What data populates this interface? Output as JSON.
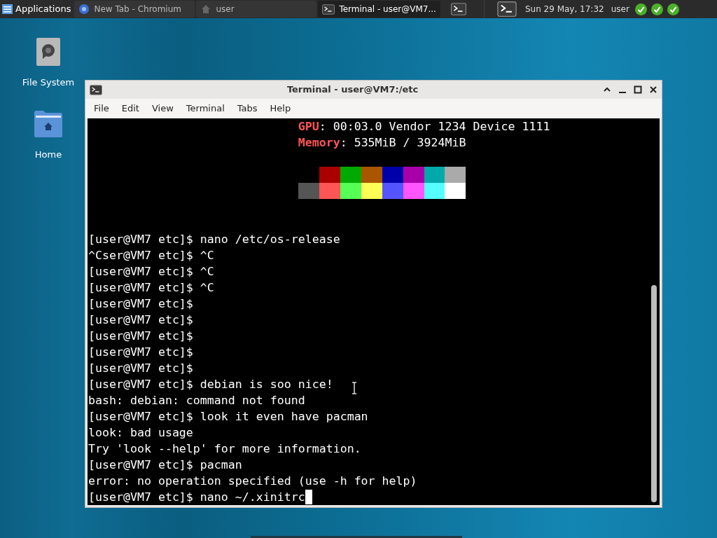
{
  "taskbar": {
    "menu": "Applications",
    "tasks": [
      {
        "label": "New Tab - Chromium",
        "kind": "browser",
        "selected": false
      },
      {
        "label": "user",
        "kind": "folder",
        "selected": false
      },
      {
        "label": "Terminal - user@VM7...",
        "kind": "terminal",
        "selected": true
      }
    ],
    "clock": "Sun 29 May, 17:32",
    "user": "user"
  },
  "desktop_icons": [
    {
      "label": "File System",
      "kind": "drive"
    },
    {
      "label": "Home",
      "kind": "home"
    }
  ],
  "window": {
    "title": "Terminal - user@VM7:/etc",
    "menu": [
      "File",
      "Edit",
      "View",
      "Terminal",
      "Tabs",
      "Help"
    ],
    "lines": [
      {
        "kind": "info",
        "key": "GPU",
        "value": ": 00:03.0 Vendor 1234 Device 1111"
      },
      {
        "kind": "info",
        "key": "Memory",
        "value": ": 535MiB / 3924MiB"
      },
      {
        "kind": "blank"
      },
      {
        "kind": "swatches",
        "indent": true,
        "swatches": [
          {
            "color": "#aa0000"
          },
          {
            "color": "#00aa00"
          },
          {
            "color": "#aa5500"
          },
          {
            "color": "#0000aa"
          },
          {
            "color": "#aa00aa"
          },
          {
            "color": "#00aaaa"
          },
          {
            "color": "#aaaaaa"
          }
        ]
      },
      {
        "kind": "swatches",
        "indent": false,
        "swatches": [
          {
            "color": "#555555"
          },
          {
            "color": "#ff5555"
          },
          {
            "color": "#55ff55"
          },
          {
            "color": "#ffff55"
          },
          {
            "color": "#5555ff"
          },
          {
            "color": "#ff55ff"
          },
          {
            "color": "#55ffff"
          },
          {
            "color": "#ffffff"
          }
        ]
      },
      {
        "kind": "blank"
      },
      {
        "kind": "blank"
      },
      {
        "kind": "text",
        "text": "[user@VM7 etc]$ nano /etc/os-release"
      },
      {
        "kind": "text",
        "text": "^Cser@VM7 etc]$ ^C"
      },
      {
        "kind": "text",
        "text": "[user@VM7 etc]$ ^C"
      },
      {
        "kind": "text",
        "text": "[user@VM7 etc]$ ^C"
      },
      {
        "kind": "text",
        "text": "[user@VM7 etc]$"
      },
      {
        "kind": "text",
        "text": "[user@VM7 etc]$"
      },
      {
        "kind": "text",
        "text": "[user@VM7 etc]$"
      },
      {
        "kind": "text",
        "text": "[user@VM7 etc]$"
      },
      {
        "kind": "text",
        "text": "[user@VM7 etc]$"
      },
      {
        "kind": "text",
        "text": "[user@VM7 etc]$ debian is soo nice!"
      },
      {
        "kind": "text",
        "text": "bash: debian: command not found"
      },
      {
        "kind": "text",
        "text": "[user@VM7 etc]$ look it even have pacman"
      },
      {
        "kind": "text",
        "text": "look: bad usage"
      },
      {
        "kind": "text",
        "text": "Try 'look --help' for more information."
      },
      {
        "kind": "text",
        "text": "[user@VM7 etc]$ pacman"
      },
      {
        "kind": "text",
        "text": "error: no operation specified (use -h for help)"
      },
      {
        "kind": "prompt",
        "text": "[user@VM7 etc]$ nano ~/.xinitrc"
      }
    ]
  }
}
